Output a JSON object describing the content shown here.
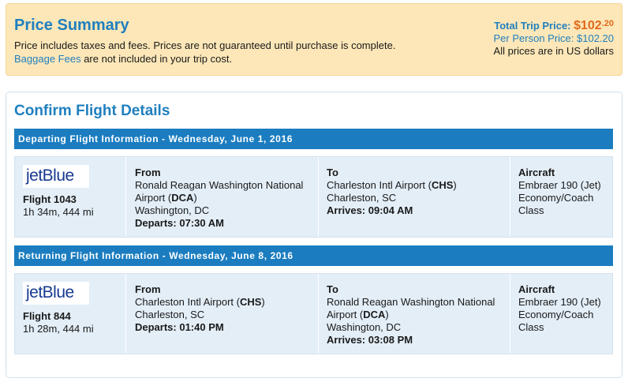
{
  "price_summary": {
    "title": "Price Summary",
    "line1": "Price includes taxes and fees. Prices are not guaranteed until purchase is complete.",
    "baggage_link": "Baggage Fees",
    "line2_rest": " are not included in your trip cost.",
    "total_label": "Total Trip Price: ",
    "total_dollars": "$102",
    "total_cents": ".20",
    "per_person": "Per Person Price: $102.20",
    "currency_note": "All prices are in US dollars"
  },
  "confirm": {
    "title": "Confirm Flight Details",
    "departing_header": "Departing Flight Information - Wednesday, June 1, 2016",
    "returning_header": "Returning Flight Information - Wednesday, June 8, 2016",
    "departing": {
      "airline_logo": "jetBlue",
      "flight": "Flight 1043",
      "duration": "1h 34m, 444 mi",
      "from_label": "From",
      "from_airport_a": "Ronald Reagan Washington National",
      "from_airport_b": "Airport (",
      "from_code": "DCA",
      "from_close": ")",
      "from_city": "Washington, DC",
      "departs": "Departs: 07:30 AM",
      "to_label": "To",
      "to_airport": "Charleston Intl Airport (",
      "to_code": "CHS",
      "to_close": ")",
      "to_city": "Charleston, SC",
      "arrives": "Arrives: 09:04 AM",
      "aircraft_label": "Aircraft",
      "aircraft": "Embraer 190 (Jet)",
      "class_a": "Economy/Coach",
      "class_b": "Class"
    },
    "returning": {
      "airline_logo": "jetBlue",
      "flight": "Flight 844",
      "duration": "1h 28m, 444 mi",
      "from_label": "From",
      "from_airport": "Charleston Intl Airport (",
      "from_code": "CHS",
      "from_close": ")",
      "from_city": "Charleston, SC",
      "departs": "Departs: 01:40 PM",
      "to_label": "To",
      "to_airport_a": "Ronald Reagan Washington National",
      "to_airport_b": "Airport (",
      "to_code": "DCA",
      "to_close": ")",
      "to_city": "Washington, DC",
      "arrives": "Arrives: 03:08 PM",
      "aircraft_label": "Aircraft",
      "aircraft": "Embraer 190 (Jet)",
      "class_a": "Economy/Coach",
      "class_b": "Class"
    }
  },
  "colors": {
    "accent_blue": "#1f7fbf",
    "header_bar": "#1b7dc0",
    "price_orange": "#e06a1a",
    "summary_bg": "#fde7b8",
    "row_bg": "#e3eef7"
  }
}
